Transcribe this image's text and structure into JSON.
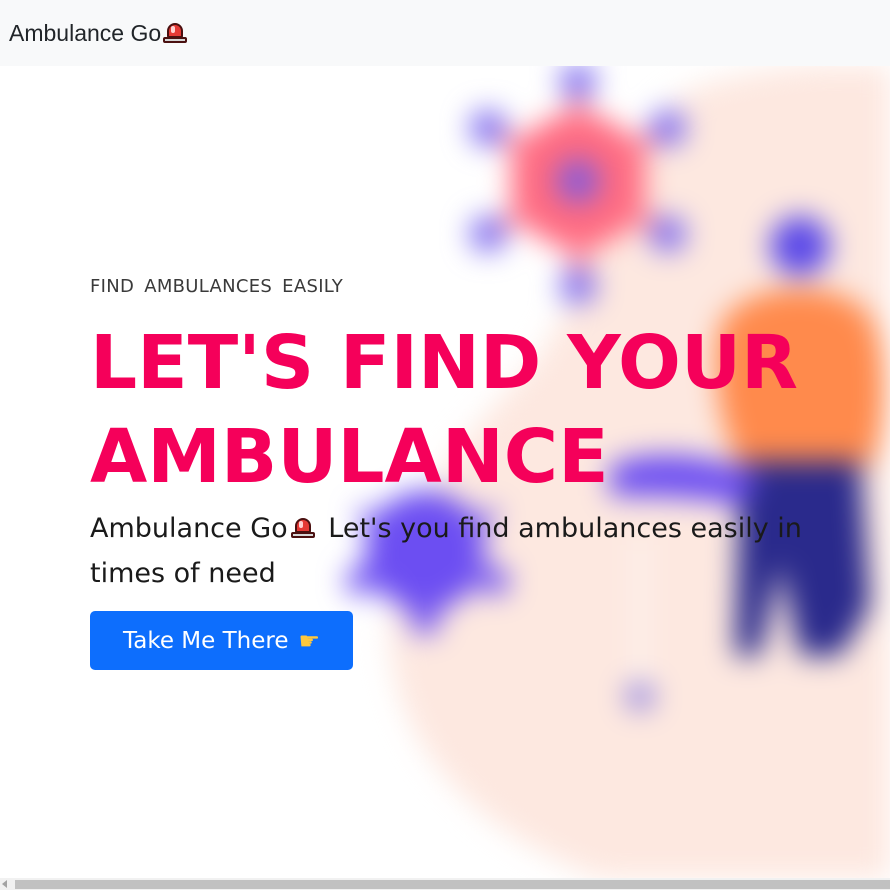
{
  "navbar": {
    "brand_label": "Ambulance Go",
    "brand_icon": "siren-icon"
  },
  "hero": {
    "eyebrow": "FIND  AMBULANCES  EASILY",
    "headline": "LET'S FIND YOUR AMBULANCE",
    "description_prefix": "Ambulance Go",
    "description_icon": "siren-icon",
    "description_suffix": "Let's you find ambulances easily in times of need",
    "cta_label": "Take Me There",
    "cta_icon": "pointing-hand-icon"
  },
  "colors": {
    "headline": "#f5005a",
    "cta_background": "#0d6efd",
    "navbar_background": "#f8f9fa",
    "blob_background": "#fde8e0",
    "virus_red": "#ff6b81",
    "virus_purple": "#6c4ef2",
    "figure_orange": "#ff8a4c",
    "figure_navy": "#2a2a8c"
  }
}
